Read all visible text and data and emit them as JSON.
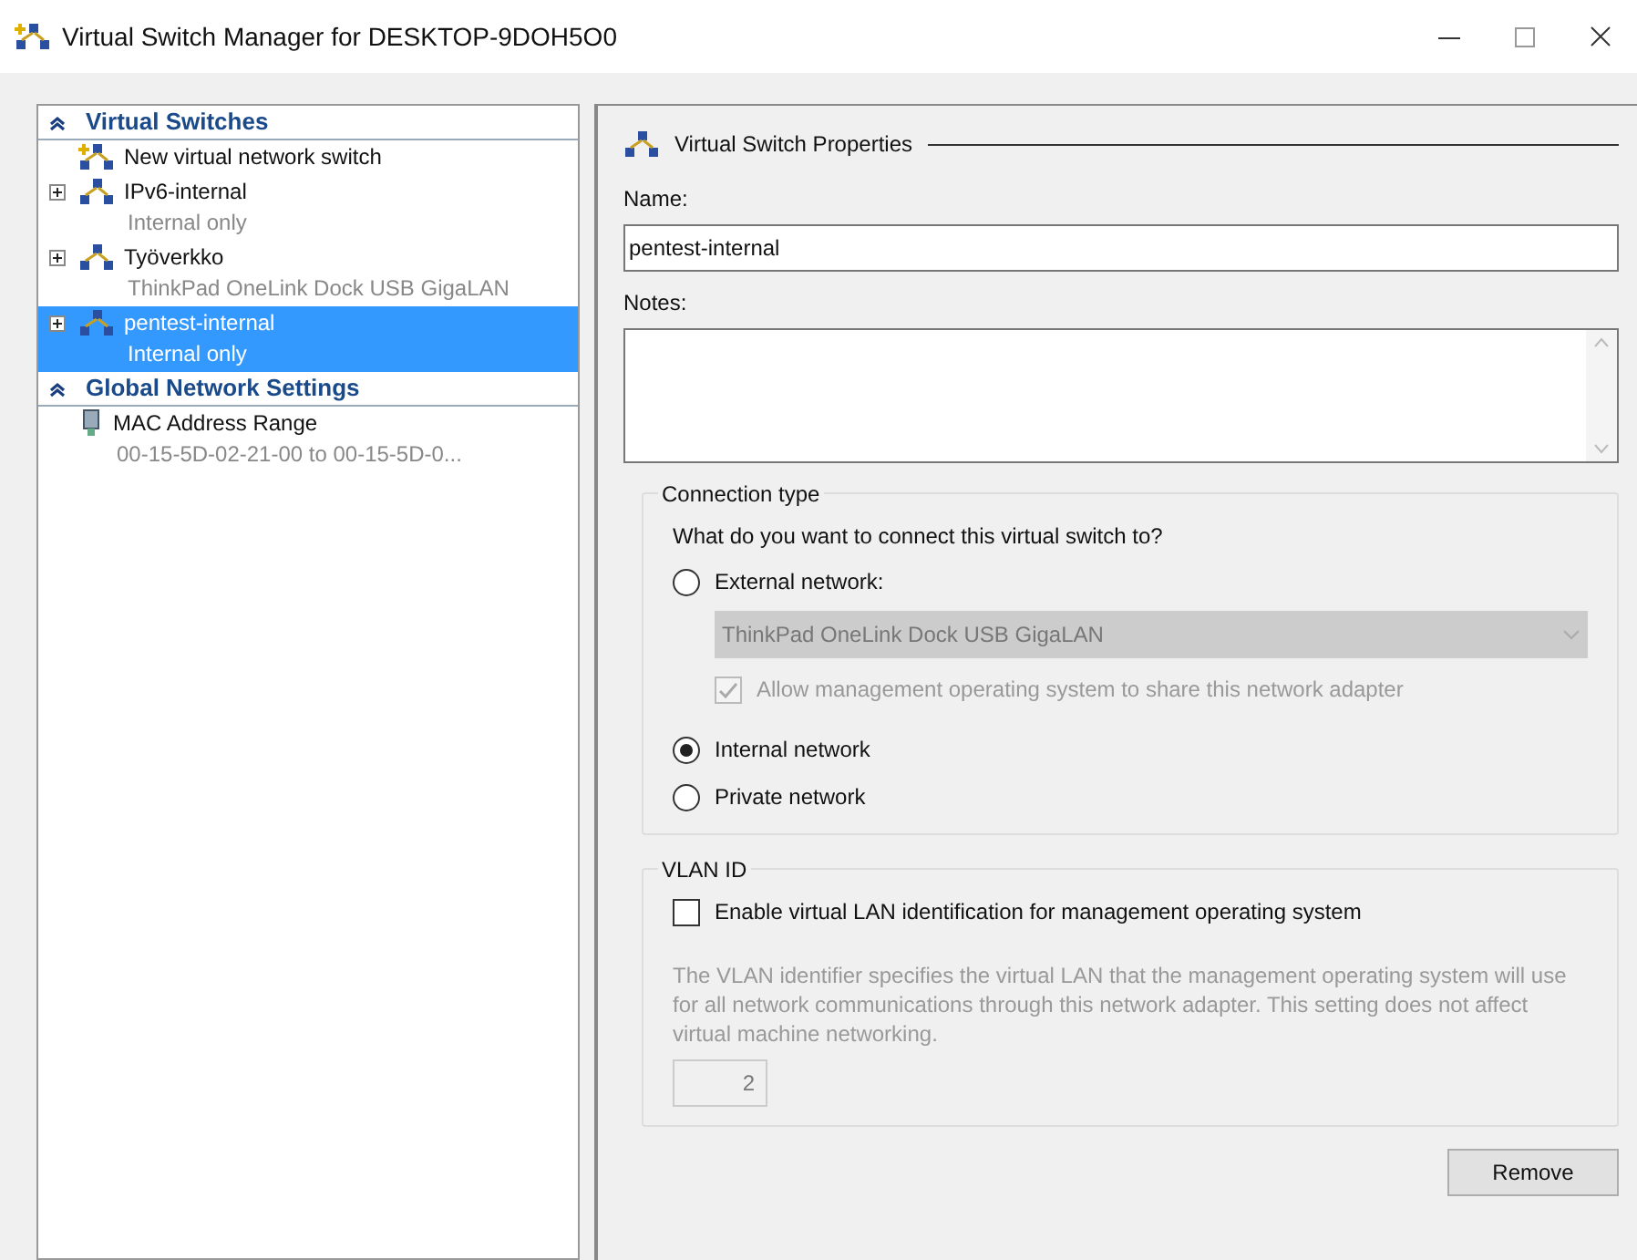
{
  "window": {
    "title": "Virtual Switch Manager for DESKTOP-9DOH5O0"
  },
  "sidebar": {
    "sections": [
      {
        "title": "Virtual Switches",
        "expanded": true,
        "items": [
          {
            "kind": "new",
            "title": "New virtual network switch",
            "expandable": false,
            "selected": false
          },
          {
            "kind": "switch",
            "title": "IPv6-internal",
            "subtitle": "Internal only",
            "expandable": true,
            "selected": false
          },
          {
            "kind": "switch",
            "title": "Työverkko",
            "subtitle": "ThinkPad OneLink Dock USB GigaLAN",
            "expandable": true,
            "selected": false
          },
          {
            "kind": "switch",
            "title": "pentest-internal",
            "subtitle": "Internal only",
            "expandable": true,
            "selected": true
          }
        ]
      },
      {
        "title": "Global Network Settings",
        "expanded": true,
        "items": [
          {
            "kind": "mac",
            "title": "MAC Address Range",
            "subtitle": "00-15-5D-02-21-00 to 00-15-5D-0...",
            "expandable": false,
            "selected": false
          }
        ]
      }
    ]
  },
  "properties": {
    "title": "Virtual Switch Properties",
    "name_label": "Name:",
    "name_value": "pentest-internal",
    "notes_label": "Notes:",
    "connection": {
      "title": "Connection type",
      "question": "What do you want to connect this virtual switch to?",
      "options": [
        {
          "label": "External network:",
          "selected": false
        },
        {
          "label": "Internal network",
          "selected": true
        },
        {
          "label": "Private network",
          "selected": false
        }
      ],
      "adapter": {
        "value": "ThinkPad OneLink Dock USB GigaLAN",
        "disabled": true
      },
      "share": {
        "label": "Allow management operating system to share this network adapter",
        "checked": true,
        "disabled": true
      }
    },
    "vlan": {
      "title": "VLAN ID",
      "enable": {
        "label": "Enable virtual LAN identification for management operating system",
        "checked": false
      },
      "description": "The VLAN identifier specifies the virtual LAN that the management operating system will use for all network communications through this network adapter. This setting does not affect virtual machine networking.",
      "id_value": "2"
    },
    "remove_button": "Remove"
  }
}
